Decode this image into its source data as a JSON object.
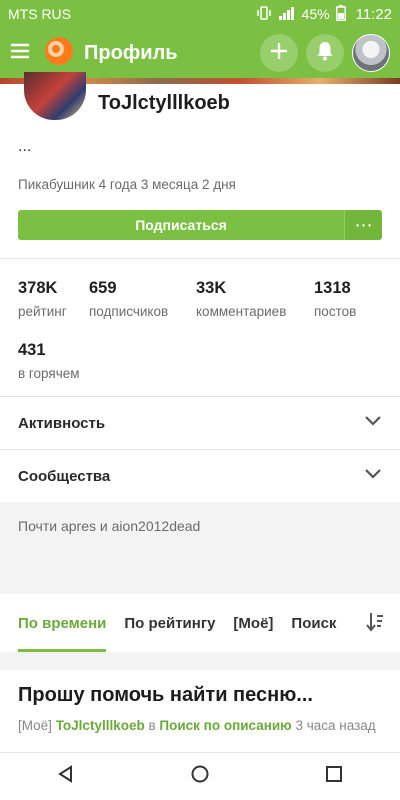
{
  "status_bar": {
    "carrier": "MTS RUS",
    "battery": "45%",
    "time": "11:22"
  },
  "app_bar": {
    "title": "Профиль"
  },
  "profile": {
    "username": "ToJlctylllkoeb",
    "bio": "...",
    "tenure": "Пикабушник 4 года 3 месяца 2 дня",
    "subscribe_label": "Подписаться",
    "more_label": "⋯"
  },
  "stats": [
    {
      "value": "378K",
      "label": "рейтинг"
    },
    {
      "value": "659",
      "label": "подписчиков"
    },
    {
      "value": "33K",
      "label": "комментариев"
    },
    {
      "value": "1318",
      "label": "постов"
    },
    {
      "value": "431",
      "label": "в горячем"
    }
  ],
  "sections": [
    {
      "label": "Активность"
    },
    {
      "label": "Сообщества"
    }
  ],
  "also": {
    "text": "Почти apres и aion2012dead"
  },
  "tabs": [
    {
      "label": "По времени",
      "active": true
    },
    {
      "label": "По рейтингу",
      "active": false
    },
    {
      "label": "[Моё]",
      "active": false
    },
    {
      "label": "Поиск",
      "active": false
    }
  ],
  "post": {
    "title": "Прошу помочь найти песню...",
    "tag": "[Моё]",
    "author": "ToJlctylllkoeb",
    "in_word": "в",
    "community": "Поиск по описанию",
    "time": "3 часа назад"
  },
  "colors": {
    "accent": "#7bc043",
    "accent_text": "#6aa93a",
    "muted": "#6b6b6b"
  }
}
